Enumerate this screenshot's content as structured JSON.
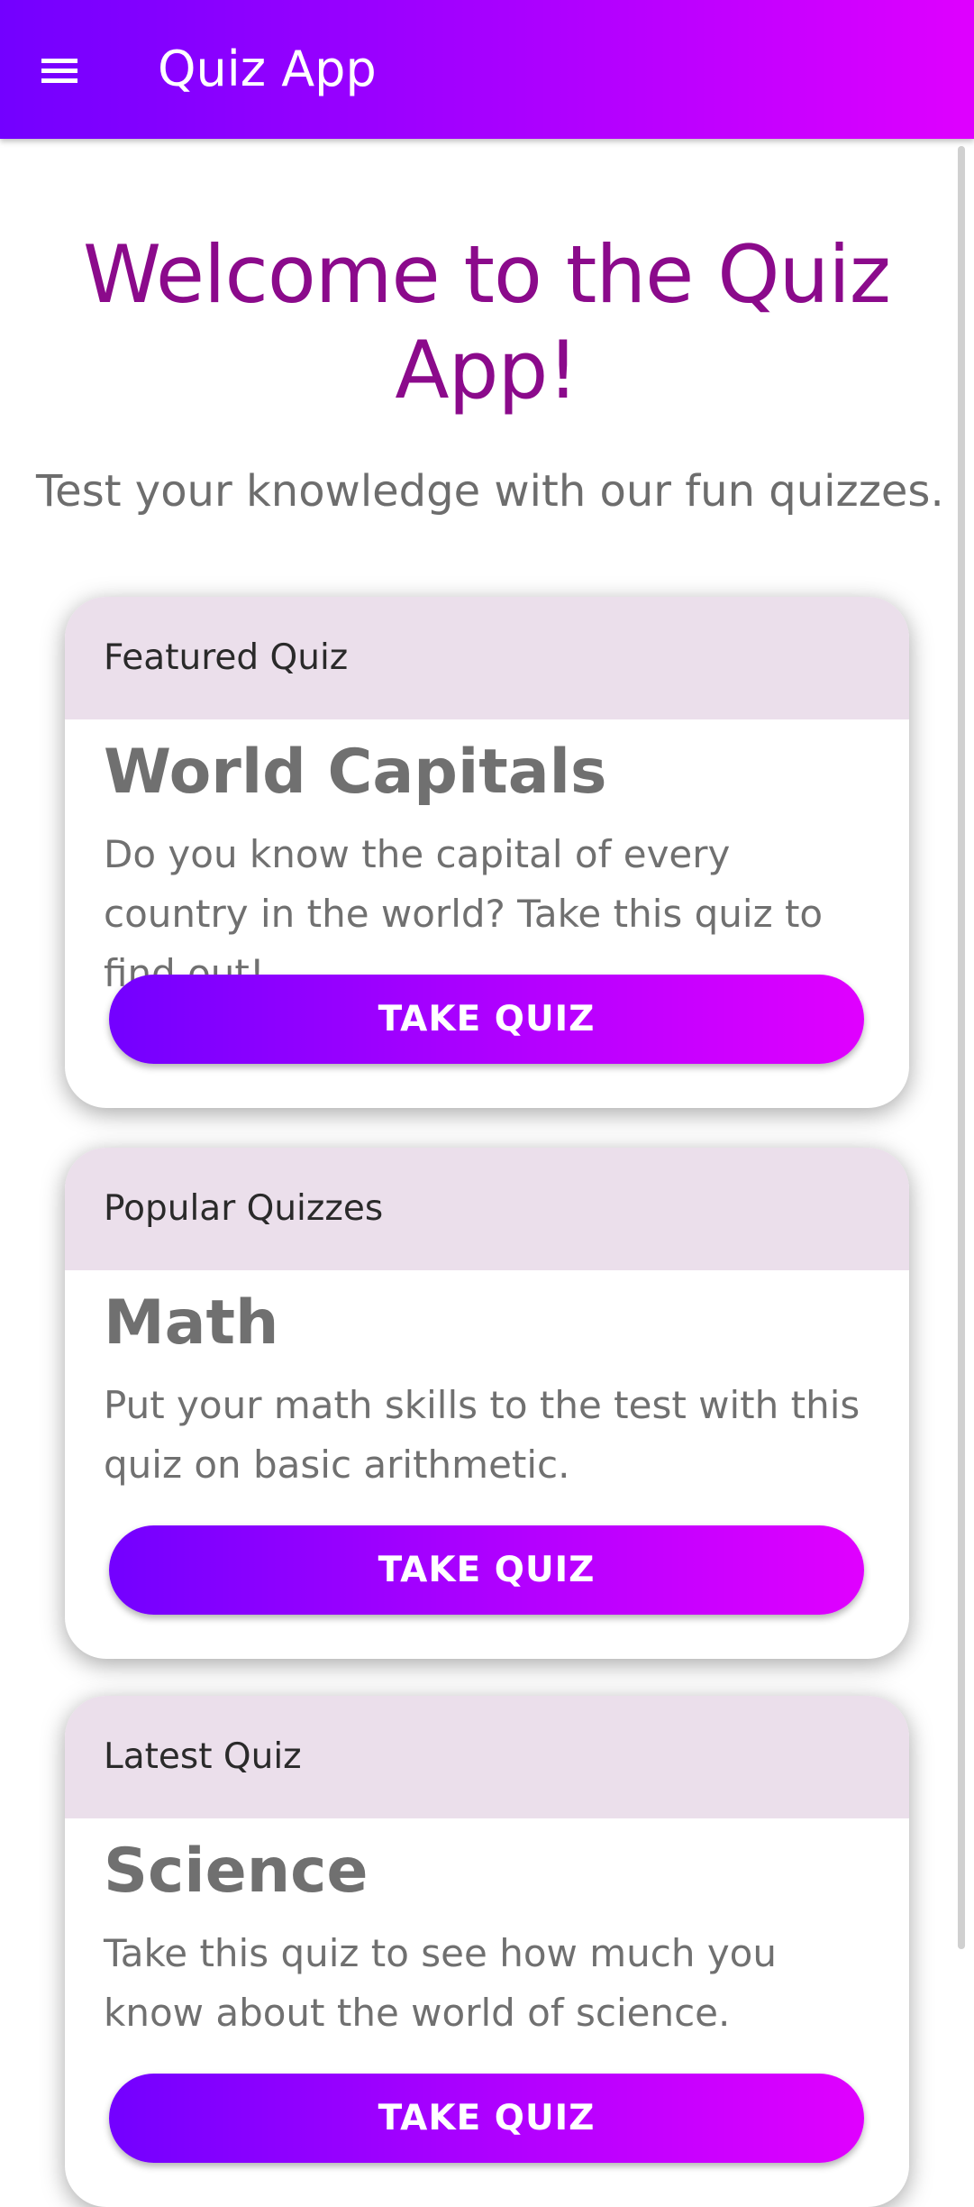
{
  "appbar": {
    "title": "Quiz App",
    "menu_icon": "menu-icon"
  },
  "hero": {
    "title": "Welcome to the Quiz App!",
    "subtitle": "Test your knowledge with our fun quizzes."
  },
  "cards": [
    {
      "header": "Featured Quiz",
      "title": "World Capitals",
      "description": "Do you know the capital of every country in the world? Take this quiz to find out!",
      "button_label": "TAKE QUIZ"
    },
    {
      "header": "Popular Quizzes",
      "title": "Math",
      "description": "Put your math skills to the test with this quiz on basic arithmetic.",
      "button_label": "TAKE QUIZ"
    },
    {
      "header": "Latest Quiz",
      "title": "Science",
      "description": "Take this quiz to see how much you know about the world of science.",
      "button_label": "TAKE QUIZ"
    }
  ],
  "colors": {
    "appbar_gradient_start": "#7300ff",
    "appbar_gradient_end": "#df00ff",
    "headline": "#8b0a8b",
    "card_header_bg": "#ebdfeb"
  }
}
